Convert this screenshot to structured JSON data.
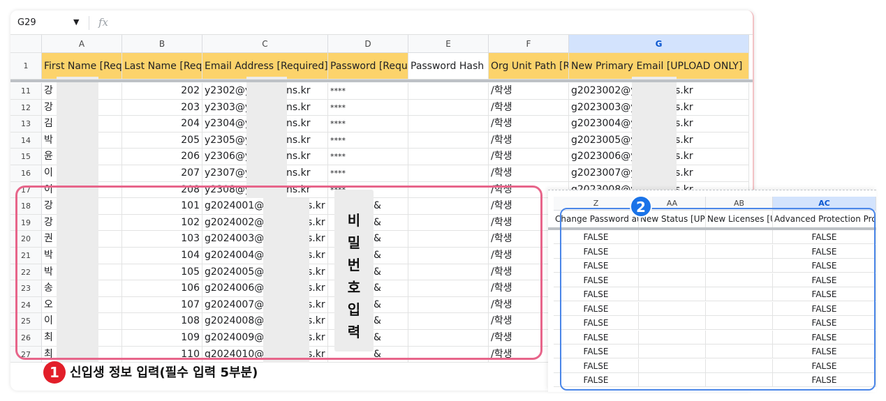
{
  "formula_bar": {
    "cell_ref": "G29",
    "caret": "▼",
    "fx": "fx"
  },
  "columns": [
    "A",
    "B",
    "C",
    "D",
    "E",
    "F",
    "G"
  ],
  "header_row_num": "1",
  "headers": [
    "First Name [Req",
    "Last Name [Req",
    "Email Address [Required]",
    "Password [Requ",
    "Password Hash",
    "Org Unit Path [R",
    "New Primary Email [UPLOAD ONLY]"
  ],
  "rows": [
    {
      "n": "11",
      "a": "강",
      "b": "202",
      "c1": "y2302@y",
      "c2": "ns.kr",
      "d": "****",
      "f": "/학생",
      "g1": "g2023002@y",
      "g2": "s.kr"
    },
    {
      "n": "12",
      "a": "강",
      "b": "203",
      "c1": "y2303@y",
      "c2": "ns.kr",
      "d": "****",
      "f": "/학생",
      "g1": "g2023003@y",
      "g2": "s.kr"
    },
    {
      "n": "13",
      "a": "김",
      "b": "204",
      "c1": "y2304@y",
      "c2": "ns.kr",
      "d": "****",
      "f": "/학생",
      "g1": "g2023004@y",
      "g2": "s.kr"
    },
    {
      "n": "14",
      "a": "박",
      "b": "205",
      "c1": "y2305@y",
      "c2": "ns.kr",
      "d": "****",
      "f": "/학생",
      "g1": "g2023005@y",
      "g2": "s.kr"
    },
    {
      "n": "15",
      "a": "윤",
      "b": "206",
      "c1": "y2306@y",
      "c2": "ns.kr",
      "d": "****",
      "f": "/학생",
      "g1": "g2023006@y",
      "g2": "s.kr"
    },
    {
      "n": "16",
      "a": "이",
      "b": "207",
      "c1": "y2307@y",
      "c2": "ns.kr",
      "d": "****",
      "f": "/학생",
      "g1": "g2023007@y",
      "g2": "s.kr"
    },
    {
      "n": "17",
      "a": "이",
      "b": "208",
      "c1": "y2308@y",
      "c2": "ns.kr",
      "d": "****",
      "f": "/학생",
      "g1": "g2023008@y",
      "g2": "s.kr"
    },
    {
      "n": "18",
      "a": "강",
      "b": "101",
      "c1": "g2024001@",
      "c2": "s.kr",
      "d": "&",
      "f": "/학생"
    },
    {
      "n": "19",
      "a": "강",
      "b": "102",
      "c1": "g2024002@",
      "c2": "s.kr",
      "d": "&",
      "f": "/학생"
    },
    {
      "n": "20",
      "a": "권",
      "b": "103",
      "c1": "g2024003@",
      "c2": "s.kr",
      "d": "&",
      "f": "/학생"
    },
    {
      "n": "21",
      "a": "박",
      "b": "104",
      "c1": "g2024004@",
      "c2": "s.kr",
      "d": "&",
      "f": "/학생"
    },
    {
      "n": "22",
      "a": "박",
      "b": "105",
      "c1": "g2024005@",
      "c2": "s.kr",
      "d": "&",
      "f": "/학생"
    },
    {
      "n": "23",
      "a": "송",
      "b": "106",
      "c1": "g2024006@",
      "c2": "s.kr",
      "d": "&",
      "f": "/학생"
    },
    {
      "n": "24",
      "a": "오",
      "b": "107",
      "c1": "g2024007@",
      "c2": "s.kr",
      "d": "&",
      "f": "/학생"
    },
    {
      "n": "25",
      "a": "이",
      "b": "108",
      "c1": "g2024008@",
      "c2": "s.kr",
      "d": "&",
      "f": "/학생"
    },
    {
      "n": "26",
      "a": "최",
      "b": "109",
      "c1": "g2024009@",
      "c2": "s.kr",
      "d": "&",
      "f": "/학생"
    },
    {
      "n": "27",
      "a": "최",
      "b": "110",
      "c1": "g2024010@",
      "c2": "s.kr",
      "d": "&",
      "f": "/학생"
    }
  ],
  "password_label_chars": [
    "비",
    "밀",
    "번",
    "호",
    "입",
    "력"
  ],
  "badge1": "1",
  "caption1": "신입생 정보 입력(필수 입력 5부분)",
  "badge2": "2",
  "overlay": {
    "columns": [
      "Z",
      "AA",
      "AB",
      "AC"
    ],
    "titles": [
      "Change Password at",
      "New Status [UPI",
      "New Licenses [U",
      "Advanced Protection Prog"
    ],
    "z_values": [
      "FALSE",
      "FALSE",
      "FALSE",
      "FALSE",
      "FALSE",
      "FALSE",
      "FALSE",
      "FALSE",
      "FALSE",
      "FALSE",
      "FALSE"
    ],
    "ac_values": [
      "FALSE",
      "FALSE",
      "FALSE",
      "FALSE",
      "FALSE",
      "FALSE",
      "FALSE",
      "FALSE",
      "FALSE",
      "FALSE",
      "FALSE"
    ]
  },
  "colors": {
    "header_yellow": "#fcd36b",
    "pink_box": "#e7658a",
    "blue_box": "#4a86e8",
    "badge_red": "#e21e29",
    "badge_blue": "#1a73e8"
  }
}
